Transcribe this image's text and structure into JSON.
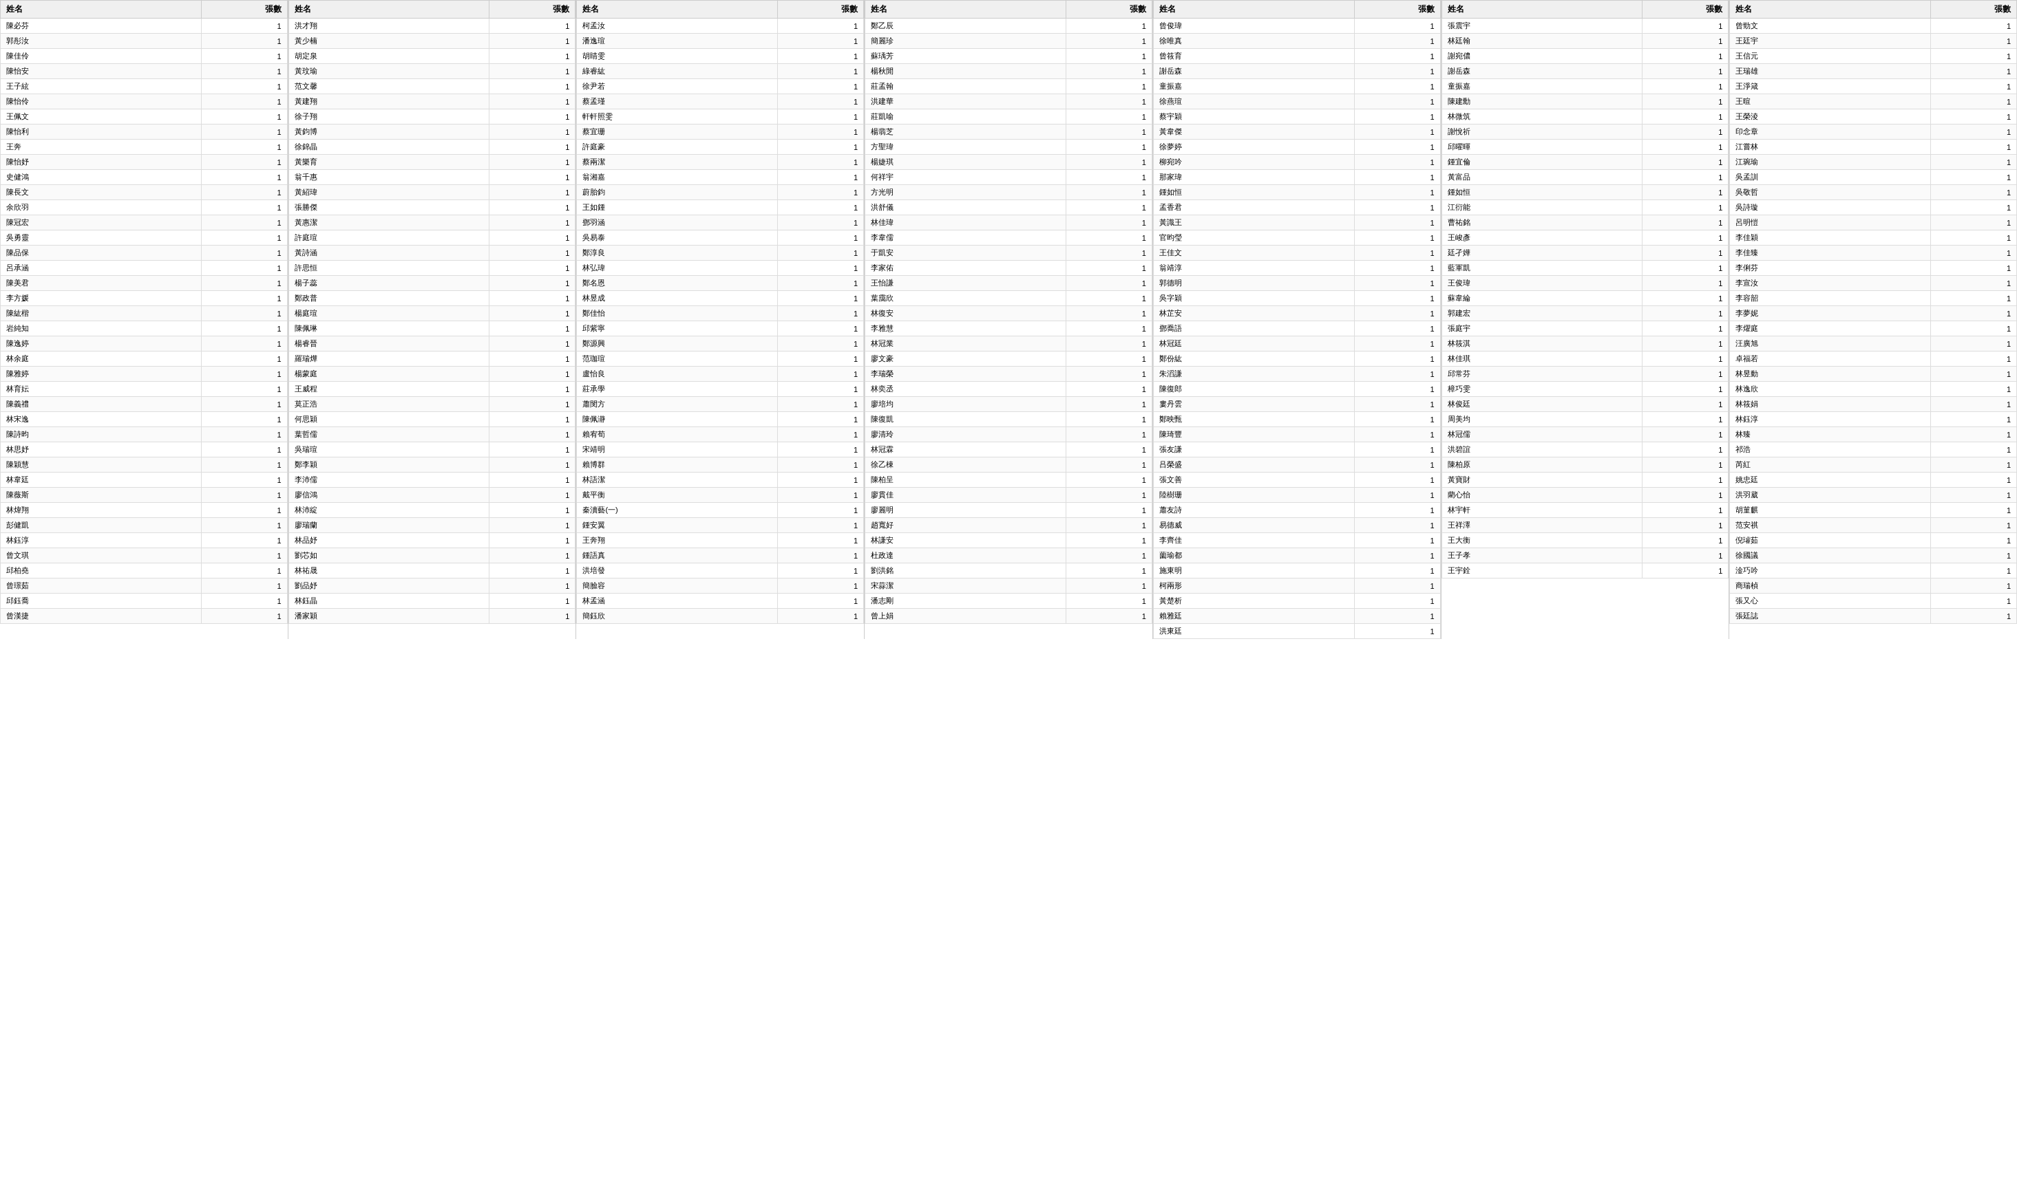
{
  "tables": [
    {
      "id": "table1",
      "headers": [
        "姓名",
        "張數"
      ],
      "rows": [
        [
          "陳必芬",
          "1"
        ],
        [
          "郭彤汝",
          "1"
        ],
        [
          "陳佳伶",
          "1"
        ],
        [
          "陳怡安",
          "1"
        ],
        [
          "王子絃",
          "1"
        ],
        [
          "陳怡伶",
          "1"
        ],
        [
          "王佩文",
          "1"
        ],
        [
          "陳怡利",
          "1"
        ],
        [
          "王奔",
          "1"
        ],
        [
          "陳怡妤",
          "1"
        ],
        [
          "史健鴻",
          "1"
        ],
        [
          "陳長文",
          "1"
        ],
        [
          "余欣羽",
          "1"
        ],
        [
          "陳冠宏",
          "1"
        ],
        [
          "吳勇靈",
          "1"
        ],
        [
          "陳品保",
          "1"
        ],
        [
          "呂承涵",
          "1"
        ],
        [
          "陳美君",
          "1"
        ],
        [
          "李方媛",
          "1"
        ],
        [
          "陳紘楷",
          "1"
        ],
        [
          "岩純知",
          "1"
        ],
        [
          "陳逸婷",
          "1"
        ],
        [
          "林余庭",
          "1"
        ],
        [
          "陳雅婷",
          "1"
        ],
        [
          "林育妘",
          "1"
        ],
        [
          "陳義禮",
          "1"
        ],
        [
          "林宋逸",
          "1"
        ],
        [
          "陳詩昀",
          "1"
        ],
        [
          "林思妤",
          "1"
        ],
        [
          "陳穎慧",
          "1"
        ],
        [
          "林韋廷",
          "1"
        ],
        [
          "陳薇斯",
          "1"
        ],
        [
          "林煒翔",
          "1"
        ],
        [
          "彭健凱",
          "1"
        ],
        [
          "林鈺淳",
          "1"
        ],
        [
          "曾文琪",
          "1"
        ],
        [
          "邱柏堯",
          "1"
        ],
        [
          "曾璟茹",
          "1"
        ],
        [
          "邱鈺喬",
          "1"
        ],
        [
          "曾漢捷",
          "1"
        ]
      ]
    },
    {
      "id": "table2",
      "headers": [
        "姓名",
        "張數"
      ],
      "rows": [
        [
          "洪才翔",
          "1"
        ],
        [
          "黃少楠",
          "1"
        ],
        [
          "胡定泉",
          "1"
        ],
        [
          "黃玟瑜",
          "1"
        ],
        [
          "范文馨",
          "1"
        ],
        [
          "黃建翔",
          "1"
        ],
        [
          "徐子翔",
          "1"
        ],
        [
          "黃鈞博",
          "1"
        ],
        [
          "徐錦晶",
          "1"
        ],
        [
          "黃樂育",
          "1"
        ],
        [
          "翁千惠",
          "1"
        ],
        [
          "黃紹瑋",
          "1"
        ],
        [
          "張勝傑",
          "1"
        ],
        [
          "黃惠潔",
          "1"
        ],
        [
          "許庭瑄",
          "1"
        ],
        [
          "黃詩涵",
          "1"
        ],
        [
          "許思恒",
          "1"
        ],
        [
          "楊子蕊",
          "1"
        ],
        [
          "鄭政普",
          "1"
        ],
        [
          "楊庭瑄",
          "1"
        ],
        [
          "陳佩琳",
          "1"
        ],
        [
          "楊睿晉",
          "1"
        ],
        [
          "羅瑞燁",
          "1"
        ],
        [
          "楊蒙庭",
          "1"
        ],
        [
          "王威程",
          "1"
        ],
        [
          "莫正浩",
          "1"
        ],
        [
          "何思穎",
          "1"
        ],
        [
          "葉哲儒",
          "1"
        ],
        [
          "吳瑞瑄",
          "1"
        ],
        [
          "鄭李穎",
          "1"
        ],
        [
          "李沛儒",
          "1"
        ],
        [
          "廖信鴻",
          "1"
        ],
        [
          "林沛綻",
          "1"
        ],
        [
          "廖瑞蘭",
          "1"
        ],
        [
          "林品妤",
          "1"
        ],
        [
          "劉芯如",
          "1"
        ],
        [
          "林祐晟",
          "1"
        ],
        [
          "劉品妤",
          "1"
        ],
        [
          "林鈺晶",
          "1"
        ],
        [
          "潘家穎",
          "1"
        ]
      ]
    },
    {
      "id": "table3",
      "headers": [
        "姓名",
        "張數"
      ],
      "rows": [
        [
          "柯孟汝",
          "1"
        ],
        [
          "潘逸瑄",
          "1"
        ],
        [
          "胡睛雯",
          "1"
        ],
        [
          "綠睿紘",
          "1"
        ],
        [
          "徐尹若",
          "1"
        ],
        [
          "蔡孟瑾",
          "1"
        ],
        [
          "軒軒照雯",
          "1"
        ],
        [
          "蔡宜珊",
          "1"
        ],
        [
          "許庭豪",
          "1"
        ],
        [
          "蔡兩潔",
          "1"
        ],
        [
          "翁湘嘉",
          "1"
        ],
        [
          "蔚胎鈞",
          "1"
        ],
        [
          "王如鍾",
          "1"
        ],
        [
          "鄧羽涵",
          "1"
        ],
        [
          "吳易泰",
          "1"
        ],
        [
          "鄭淳良",
          "1"
        ],
        [
          "林弘瑋",
          "1"
        ],
        [
          "鄭名恩",
          "1"
        ],
        [
          "林昱成",
          "1"
        ],
        [
          "鄭佳怡",
          "1"
        ],
        [
          "邱紫寧",
          "1"
        ],
        [
          "鄭源興",
          "1"
        ],
        [
          "范珈瑄",
          "1"
        ],
        [
          "盧怡良",
          "1"
        ],
        [
          "莊承學",
          "1"
        ],
        [
          "蕭閔方",
          "1"
        ],
        [
          "陳佩瀞",
          "1"
        ],
        [
          "賴宥荀",
          "1"
        ],
        [
          "宋靖明",
          "1"
        ],
        [
          "賴博群",
          "1"
        ],
        [
          "林語潔",
          "1"
        ],
        [
          "戴平衡",
          "1"
        ],
        [
          "秦瀆藝(一)",
          "1"
        ],
        [
          "鍾安翼",
          "1"
        ],
        [
          "王奔翔",
          "1"
        ],
        [
          "鍾語真",
          "1"
        ],
        [
          "洪培發",
          "1"
        ],
        [
          "簡臉容",
          "1"
        ],
        [
          "林孟涵",
          "1"
        ],
        [
          "簡鈺欣",
          "1"
        ]
      ]
    },
    {
      "id": "table4",
      "headers": [
        "姓名",
        "張數"
      ],
      "rows": [
        [
          "鄭乙辰",
          "1"
        ],
        [
          "簡麗珍",
          "1"
        ],
        [
          "蘇瑀芳",
          "1"
        ],
        [
          "楊秋閒",
          "1"
        ],
        [
          "莊孟翰",
          "1"
        ],
        [
          "洪建華",
          "1"
        ],
        [
          "莊凱喻",
          "1"
        ],
        [
          "楊翡芝",
          "1"
        ],
        [
          "方聖瑋",
          "1"
        ],
        [
          "楊婕琪",
          "1"
        ],
        [
          "何祥宇",
          "1"
        ],
        [
          "方光明",
          "1"
        ],
        [
          "洪舒儀",
          "1"
        ],
        [
          "林佳瑋",
          "1"
        ],
        [
          "李韋儒",
          "1"
        ],
        [
          "于凱安",
          "1"
        ],
        [
          "李家佑",
          "1"
        ],
        [
          "王怡謙",
          "1"
        ],
        [
          "葉靄欣",
          "1"
        ],
        [
          "林復安",
          "1"
        ],
        [
          "李雅慧",
          "1"
        ],
        [
          "林冠業",
          "1"
        ],
        [
          "廖文豪",
          "1"
        ],
        [
          "李瑞榮",
          "1"
        ],
        [
          "林奕丞",
          "1"
        ],
        [
          "廖培均",
          "1"
        ],
        [
          "陳復凱",
          "1"
        ],
        [
          "廖清玲",
          "1"
        ],
        [
          "林冠霖",
          "1"
        ],
        [
          "徐乙棟",
          "1"
        ],
        [
          "陳柏呈",
          "1"
        ],
        [
          "廖貫佳",
          "1"
        ],
        [
          "廖麗明",
          "1"
        ],
        [
          "趙寬好",
          "1"
        ],
        [
          "林謙安",
          "1"
        ],
        [
          "杜政達",
          "1"
        ],
        [
          "劉洪銘",
          "1"
        ],
        [
          "宋蒜潔",
          "1"
        ],
        [
          "潘志剛",
          "1"
        ],
        [
          "曾上娟",
          "1"
        ]
      ]
    },
    {
      "id": "table5",
      "headers": [
        "姓名",
        "張數"
      ],
      "rows": [
        [
          "曾俊瑋",
          "1"
        ],
        [
          "徐唯真",
          "1"
        ],
        [
          "曾筱育",
          "1"
        ],
        [
          "謝岳森",
          "1"
        ],
        [
          "童振嘉",
          "1"
        ],
        [
          "徐燕瑄",
          "1"
        ],
        [
          "蔡宇穎",
          "1"
        ],
        [
          "黃韋傑",
          "1"
        ],
        [
          "徐夢婷",
          "1"
        ],
        [
          "柳宛吟",
          "1"
        ],
        [
          "那家瑋",
          "1"
        ],
        [
          "鍾如恒",
          "1"
        ],
        [
          "孟香君",
          "1"
        ],
        [
          "黃識王",
          "1"
        ],
        [
          "官昀瑩",
          "1"
        ],
        [
          "王佳文",
          "1"
        ],
        [
          "翁靖淳",
          "1"
        ],
        [
          "郭德明",
          "1"
        ],
        [
          "吳字穎",
          "1"
        ],
        [
          "林芷安",
          "1"
        ],
        [
          "鄧喬語",
          "1"
        ],
        [
          "林冠廷",
          "1"
        ],
        [
          "鄭份紘",
          "1"
        ],
        [
          "朱滔謙",
          "1"
        ],
        [
          "陳復郎",
          "1"
        ],
        [
          "婁丹雲",
          "1"
        ],
        [
          "鄭映甄",
          "1"
        ],
        [
          "陳琦豐",
          "1"
        ],
        [
          "張友謙",
          "1"
        ],
        [
          "吕榮盛",
          "1"
        ],
        [
          "張文善",
          "1"
        ],
        [
          "陸樹珊",
          "1"
        ],
        [
          "蕭友詩",
          "1"
        ],
        [
          "易德威",
          "1"
        ],
        [
          "李齊佳",
          "1"
        ],
        [
          "薗瑜都",
          "1"
        ],
        [
          "施東明",
          "1"
        ],
        [
          "柯兩形",
          "1"
        ],
        [
          "黃楚析",
          "1"
        ],
        [
          "賴雅廷",
          "1"
        ],
        [
          "洪東廷",
          "1"
        ]
      ]
    },
    {
      "id": "table6",
      "headers": [
        "姓名",
        "張數"
      ],
      "rows": [
        [
          "張震宇",
          "1"
        ],
        [
          "林廷翰",
          "1"
        ],
        [
          "謝宛儂",
          "1"
        ],
        [
          "謝岳森",
          "1"
        ],
        [
          "童振嘉",
          "1"
        ],
        [
          "陳建勳",
          "1"
        ],
        [
          "林微筑",
          "1"
        ],
        [
          "謝悅祈",
          "1"
        ],
        [
          "邱曜暉",
          "1"
        ],
        [
          "鍾宜倫",
          "1"
        ],
        [
          "黃富品",
          "1"
        ],
        [
          "鍾如恒",
          "1"
        ],
        [
          "江衍能",
          "1"
        ],
        [
          "曹祐銘",
          "1"
        ],
        [
          "王峻彥",
          "1"
        ],
        [
          "廷孑嬅",
          "1"
        ],
        [
          "藍軍凱",
          "1"
        ],
        [
          "王俊瑋",
          "1"
        ],
        [
          "蘇韋綸",
          "1"
        ],
        [
          "郭建宏",
          "1"
        ],
        [
          "張庭宇",
          "1"
        ],
        [
          "林筱淇",
          "1"
        ],
        [
          "林佳琪",
          "1"
        ],
        [
          "邱常芬",
          "1"
        ],
        [
          "樟巧雯",
          "1"
        ],
        [
          "林俊廷",
          "1"
        ],
        [
          "周美均",
          "1"
        ],
        [
          "林冠儒",
          "1"
        ],
        [
          "洪碧誼",
          "1"
        ],
        [
          "陳柏原",
          "1"
        ],
        [
          "黃寶財",
          "1"
        ],
        [
          "藺心怡",
          "1"
        ],
        [
          "林宇軒",
          "1"
        ],
        [
          "王祥澤",
          "1"
        ],
        [
          "王大衡",
          "1"
        ],
        [
          "王子孝",
          "1"
        ],
        [
          "王宇銓",
          "1"
        ]
      ]
    },
    {
      "id": "table7",
      "headers": [
        "姓名",
        "張數"
      ],
      "rows": [
        [
          "曾勁文",
          "1"
        ],
        [
          "王廷宇",
          "1"
        ],
        [
          "王信元",
          "1"
        ],
        [
          "王瑞雄",
          "1"
        ],
        [
          "王淨箴",
          "1"
        ],
        [
          "王暄",
          "1"
        ],
        [
          "王榮淩",
          "1"
        ],
        [
          "印念章",
          "1"
        ],
        [
          "江嘗林",
          "1"
        ],
        [
          "江琬瑜",
          "1"
        ],
        [
          "吳孟訓",
          "1"
        ],
        [
          "吳敬哲",
          "1"
        ],
        [
          "吳詩璇",
          "1"
        ],
        [
          "呂明愷",
          "1"
        ],
        [
          "李佳穎",
          "1"
        ],
        [
          "李佳臻",
          "1"
        ],
        [
          "李俐芬",
          "1"
        ],
        [
          "李宣汝",
          "1"
        ],
        [
          "李容韶",
          "1"
        ],
        [
          "李夢妮",
          "1"
        ],
        [
          "李燿庭",
          "1"
        ],
        [
          "汪廣旭",
          "1"
        ],
        [
          "卓福若",
          "1"
        ],
        [
          "林昱動",
          "1"
        ],
        [
          "林逸欣",
          "1"
        ],
        [
          "林筱娟",
          "1"
        ],
        [
          "林鈺淳",
          "1"
        ],
        [
          "林臻",
          "1"
        ],
        [
          "祁浩",
          "1"
        ],
        [
          "芮紅",
          "1"
        ],
        [
          "姚忠廷",
          "1"
        ],
        [
          "洪羽葳",
          "1"
        ],
        [
          "胡菫麒",
          "1"
        ],
        [
          "范安祺",
          "1"
        ],
        [
          "倪璿茹",
          "1"
        ],
        [
          "徐國議",
          "1"
        ],
        [
          "淦巧吟",
          "1"
        ],
        [
          "商瑞楨",
          "1"
        ],
        [
          "張又心",
          "1"
        ],
        [
          "張廷誌",
          "1"
        ]
      ]
    }
  ]
}
